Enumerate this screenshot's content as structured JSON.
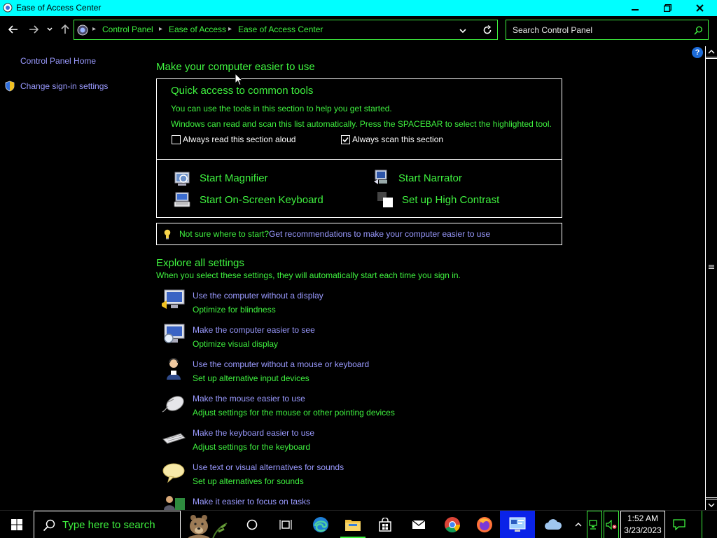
{
  "window": {
    "title": "Ease of Access Center"
  },
  "address_bar": {
    "breadcrumbs": [
      "Control Panel",
      "Ease of Access",
      "Ease of Access Center"
    ]
  },
  "search": {
    "placeholder": "Search Control Panel"
  },
  "left_pane": {
    "home_link": "Control Panel Home",
    "signin_link": "Change sign-in settings"
  },
  "main": {
    "heading": "Make your computer easier to use",
    "quick_access": {
      "title": "Quick access to common tools",
      "line1": "You can use the tools in this section to help you get started.",
      "line2": "Windows can read and scan this list automatically.  Press the SPACEBAR to select the highlighted tool.",
      "read_aloud": {
        "label": "Always read this section aloud",
        "checked": false
      },
      "scan": {
        "label": "Always scan this section",
        "checked": true
      },
      "tools": {
        "magnifier": "Start Magnifier",
        "narrator": "Start Narrator",
        "osk": "Start On-Screen Keyboard",
        "contrast": "Set up High Contrast"
      }
    },
    "tip": {
      "prefix": "Not sure where to start?",
      "link": "Get recommendations to make your computer easier to use"
    },
    "explore": {
      "heading": "Explore all settings",
      "subtitle": "When you select these settings, they will automatically start each time you sign in.",
      "items": [
        {
          "link": "Use the computer without a display",
          "desc": "Optimize for blindness",
          "icon": "display-icon"
        },
        {
          "link": "Make the computer easier to see",
          "desc": "Optimize visual display",
          "icon": "magnify-display-icon"
        },
        {
          "link": "Use the computer without a mouse or keyboard",
          "desc": "Set up alternative input devices",
          "icon": "person-headset-icon"
        },
        {
          "link": "Make the mouse easier to use",
          "desc": "Adjust settings for the mouse or other pointing devices",
          "icon": "mouse-icon"
        },
        {
          "link": "Make the keyboard easier to use",
          "desc": "Adjust settings for the keyboard",
          "icon": "keyboard-icon"
        },
        {
          "link": "Use text or visual alternatives for sounds",
          "desc": "Set up alternatives for sounds",
          "icon": "speech-bubble-icon"
        },
        {
          "link": "Make it easier to focus on tasks",
          "desc": "",
          "icon": "focus-person-icon"
        }
      ]
    }
  },
  "taskbar": {
    "search_placeholder": "Type here to search",
    "time": "1:52 AM",
    "date": "3/23/2023"
  },
  "colors": {
    "title_bar": "#00ffff",
    "text_green": "#3ff23f",
    "link_purple": "#9a9aff",
    "taskbar_active": "#0a23e8"
  }
}
